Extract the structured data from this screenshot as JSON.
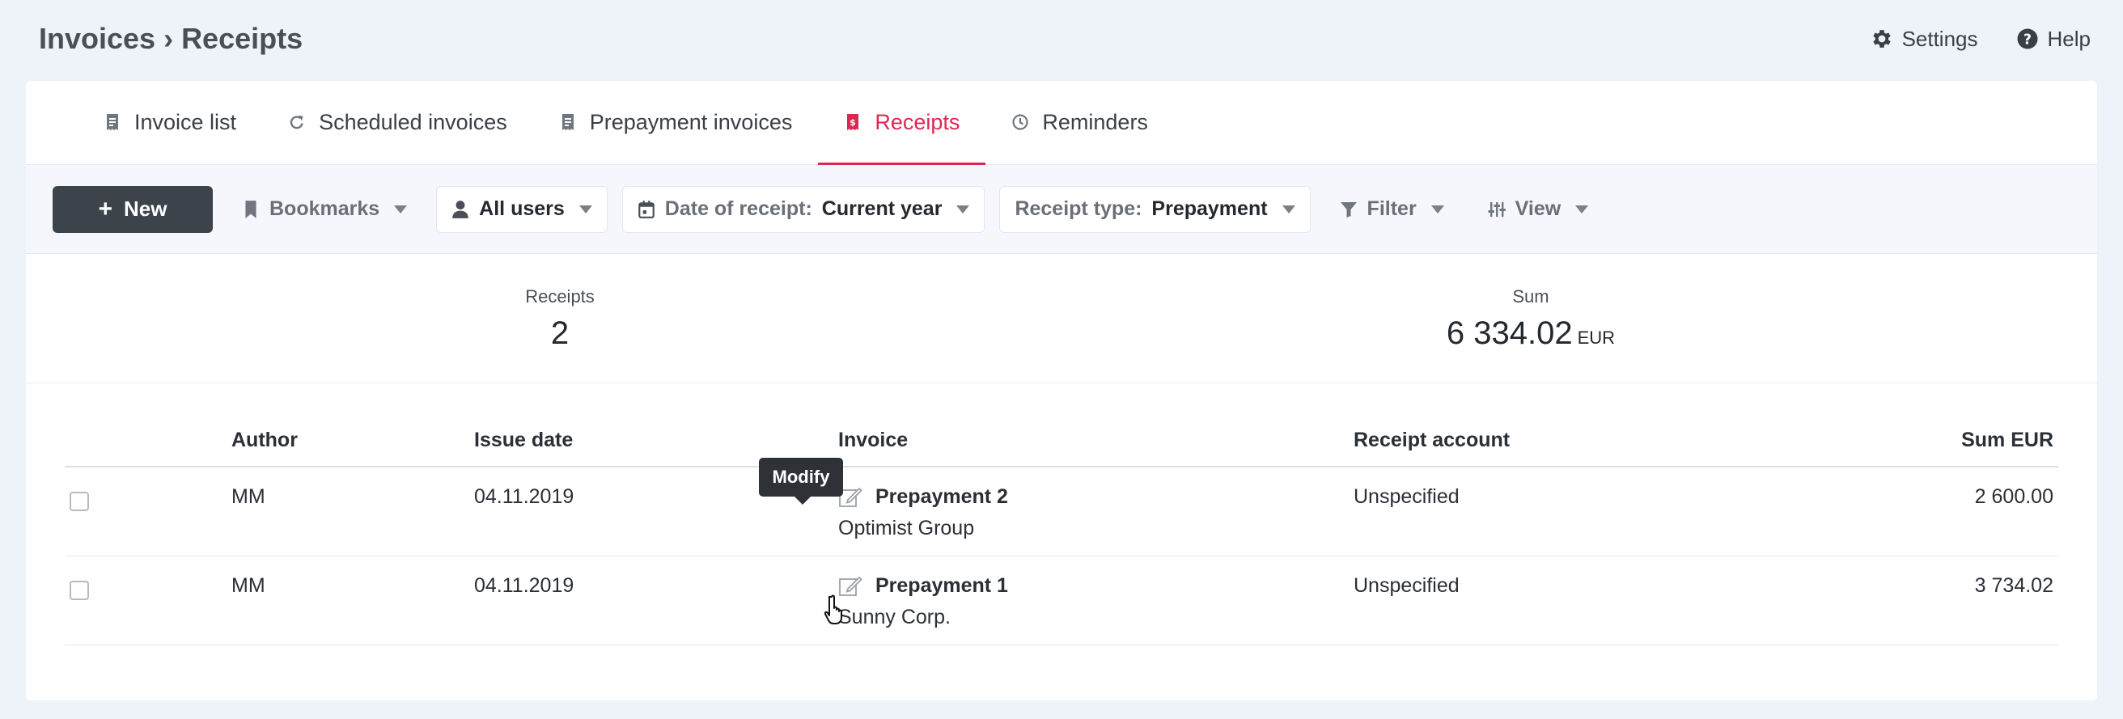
{
  "header": {
    "title": "Invoices › Receipts",
    "settings_label": "Settings",
    "help_label": "Help"
  },
  "tabs": [
    {
      "label": "Invoice list",
      "icon": "invoice-icon"
    },
    {
      "label": "Scheduled invoices",
      "icon": "refresh-icon"
    },
    {
      "label": "Prepayment invoices",
      "icon": "invoice-icon"
    },
    {
      "label": "Receipts",
      "icon": "receipt-icon",
      "active": true
    },
    {
      "label": "Reminders",
      "icon": "clock-icon"
    }
  ],
  "toolbar": {
    "new_label": "New",
    "bookmarks_label": "Bookmarks",
    "users_label": "All users",
    "date_label": "Date of receipt:",
    "date_value": "Current year",
    "type_label": "Receipt type:",
    "type_value": "Prepayment",
    "filter_label": "Filter",
    "view_label": "View"
  },
  "summary": {
    "receipts_label": "Receipts",
    "receipts_value": "2",
    "sum_label": "Sum",
    "sum_value": "6 334.02",
    "sum_unit": "EUR"
  },
  "table": {
    "headers": {
      "author": "Author",
      "issue_date": "Issue date",
      "invoice": "Invoice",
      "receipt_account": "Receipt account",
      "sum": "Sum EUR"
    },
    "rows": [
      {
        "author": "MM",
        "issue_date": "04.11.2019",
        "invoice": "Prepayment 2",
        "client": "Optimist Group",
        "account": "Unspecified",
        "sum": "2 600.00"
      },
      {
        "author": "MM",
        "issue_date": "04.11.2019",
        "invoice": "Prepayment 1",
        "client": "Sunny Corp.",
        "account": "Unspecified",
        "sum": "3 734.02"
      }
    ]
  },
  "tooltip": {
    "label": "Modify"
  },
  "colors": {
    "accent": "#dd2753",
    "primary_button": "#3d434b",
    "background": "#eef2f9"
  }
}
